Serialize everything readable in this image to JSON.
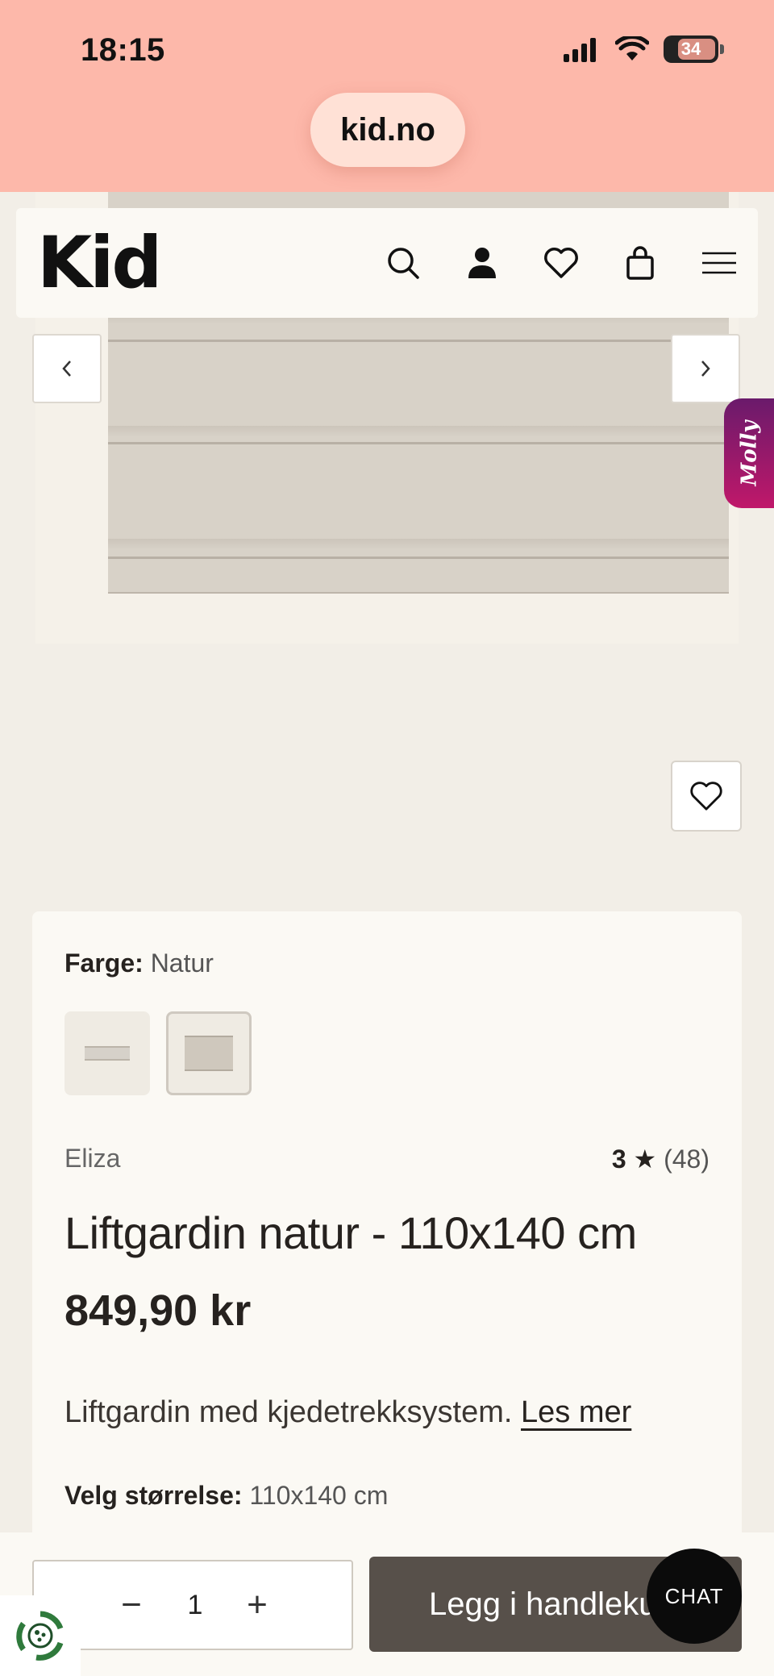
{
  "status_bar": {
    "time": "18:15",
    "battery": "34"
  },
  "browser": {
    "url": "kid.no"
  },
  "header": {
    "logo": "Kid"
  },
  "molly_tab": {
    "label": "Molly"
  },
  "product": {
    "color_label": "Farge:",
    "color_value": "Natur",
    "brand": "Eliza",
    "rating_score": "3",
    "rating_star": "★",
    "rating_count": "(48)",
    "title": "Liftgardin natur - 110x140 cm",
    "price": "849,90 kr",
    "description": "Liftgardin med kjedetrekksystem.",
    "read_more": "Les mer",
    "size_label": "Velg størrelse:",
    "size_value": "110x140 cm"
  },
  "cart": {
    "quantity": "1",
    "minus": "−",
    "plus": "+",
    "add_label": "Legg i handlekurv"
  },
  "chat": {
    "label": "CHAT"
  },
  "colors": {
    "status_bg": "#fdb8aa",
    "page_bg": "#f2eee7",
    "cta_bg": "#57504a",
    "molly": "#c0186a"
  }
}
